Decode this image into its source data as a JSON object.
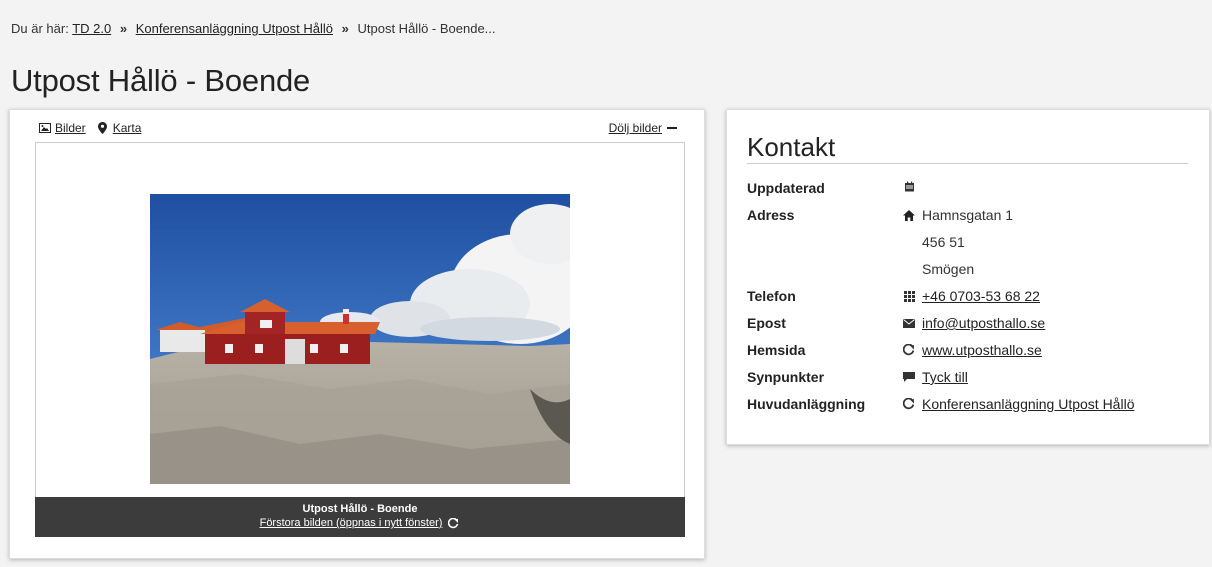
{
  "breadcrumb": {
    "prefix": "Du är här:",
    "items": [
      "TD 2.0",
      "Konferensanläggning Utpost Hållö"
    ],
    "current": "Utpost Hållö - Boende...",
    "separator": "»"
  },
  "page": {
    "title": "Utpost Hållö - Boende"
  },
  "media": {
    "tabs": [
      {
        "label": "Bilder",
        "icon": "image-icon"
      },
      {
        "label": "Karta",
        "icon": "map-marker-icon"
      }
    ],
    "hide_label": "Dölj bilder",
    "caption_title": "Utpost Hållö - Boende",
    "caption_link": "Förstora bilden (öppnas i nytt fönster)"
  },
  "contact": {
    "title": "Kontakt",
    "labels": {
      "updated": "Uppdaterad",
      "address": "Adress",
      "phone": "Telefon",
      "email": "Epost",
      "website": "Hemsida",
      "feedback": "Synpunkter",
      "main": "Huvudanläggning"
    },
    "address": {
      "street": "Hamnsgatan 1",
      "postal": "456 51",
      "city": "Smögen"
    },
    "phone": "+46 0703-53 68 22",
    "email": "info@utposthallo.se",
    "website": "www.utposthallo.se",
    "feedback": "Tyck till",
    "main": "Konferensanläggning Utpost Hållö"
  },
  "colors": {
    "background": "#f3f3f3",
    "caption_bar": "#3c3c3c",
    "card": "#ffffff"
  }
}
